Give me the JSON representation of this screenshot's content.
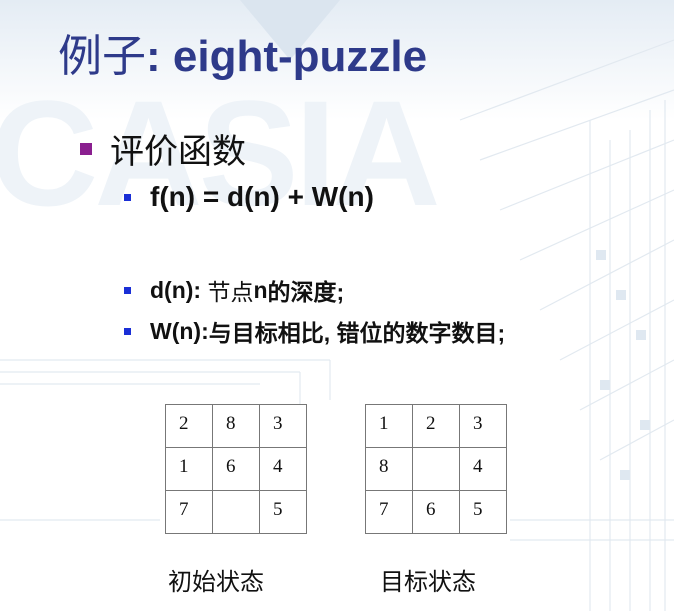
{
  "title": {
    "cjk": "例子",
    "en": ": eight-puzzle"
  },
  "bullets": {
    "level1": "评价函数",
    "formula": "f(n) = d(n) + W(n)",
    "d_term": "d(n):",
    "d_desc": " 节点",
    "d_n": "n",
    "d_desc2": "的深度;",
    "w_term": "W(n):",
    "w_desc": "与目标相比, 错位的数字数目;"
  },
  "puzzles": {
    "initial": {
      "caption": "初始状态",
      "rows": [
        [
          "2",
          "8",
          "3"
        ],
        [
          "1",
          "6",
          "4"
        ],
        [
          "7",
          "",
          "5"
        ]
      ]
    },
    "goal": {
      "caption": "目标状态",
      "rows": [
        [
          "1",
          "2",
          "3"
        ],
        [
          "8",
          "",
          "4"
        ],
        [
          "7",
          "6",
          "5"
        ]
      ]
    }
  },
  "colors": {
    "title": "#2e3a8a",
    "level1_bullet": "#8a1f8f",
    "level2_bullet": "#1a2fd6"
  },
  "decor": {
    "watermark": "CASIA"
  }
}
